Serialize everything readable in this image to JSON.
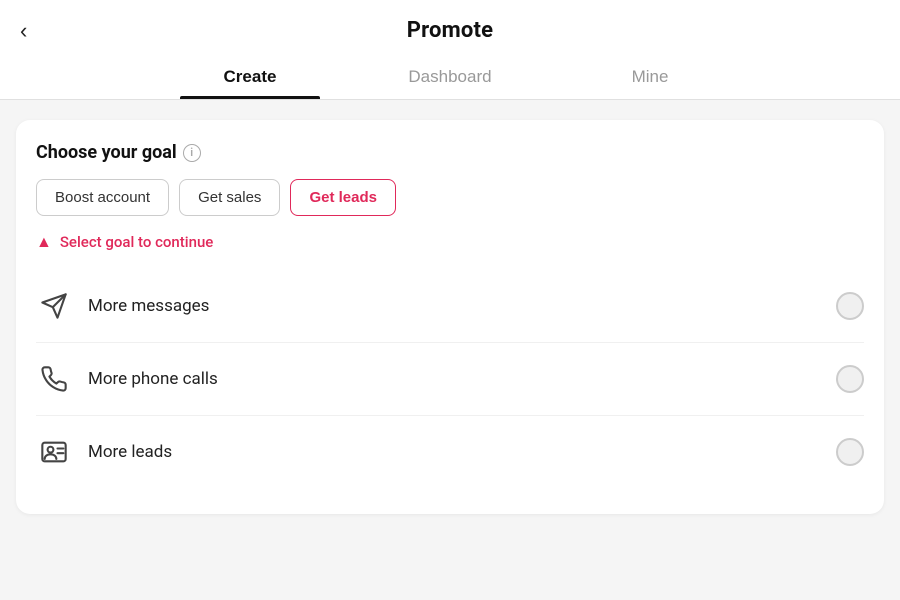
{
  "header": {
    "back_label": "‹",
    "title": "Promote"
  },
  "tabs": [
    {
      "label": "Create",
      "active": true
    },
    {
      "label": "Dashboard",
      "active": false
    },
    {
      "label": "Mine",
      "active": false
    }
  ],
  "card": {
    "section_title": "Choose your goal",
    "info_icon_label": "i",
    "goal_buttons": [
      {
        "label": "Boost account",
        "selected": false
      },
      {
        "label": "Get sales",
        "selected": false
      },
      {
        "label": "Get leads",
        "selected": true
      }
    ],
    "warning_text": "Select goal to continue",
    "options": [
      {
        "label": "More messages",
        "icon": "message-icon"
      },
      {
        "label": "More phone calls",
        "icon": "phone-icon"
      },
      {
        "label": "More leads",
        "icon": "leads-icon"
      }
    ]
  }
}
